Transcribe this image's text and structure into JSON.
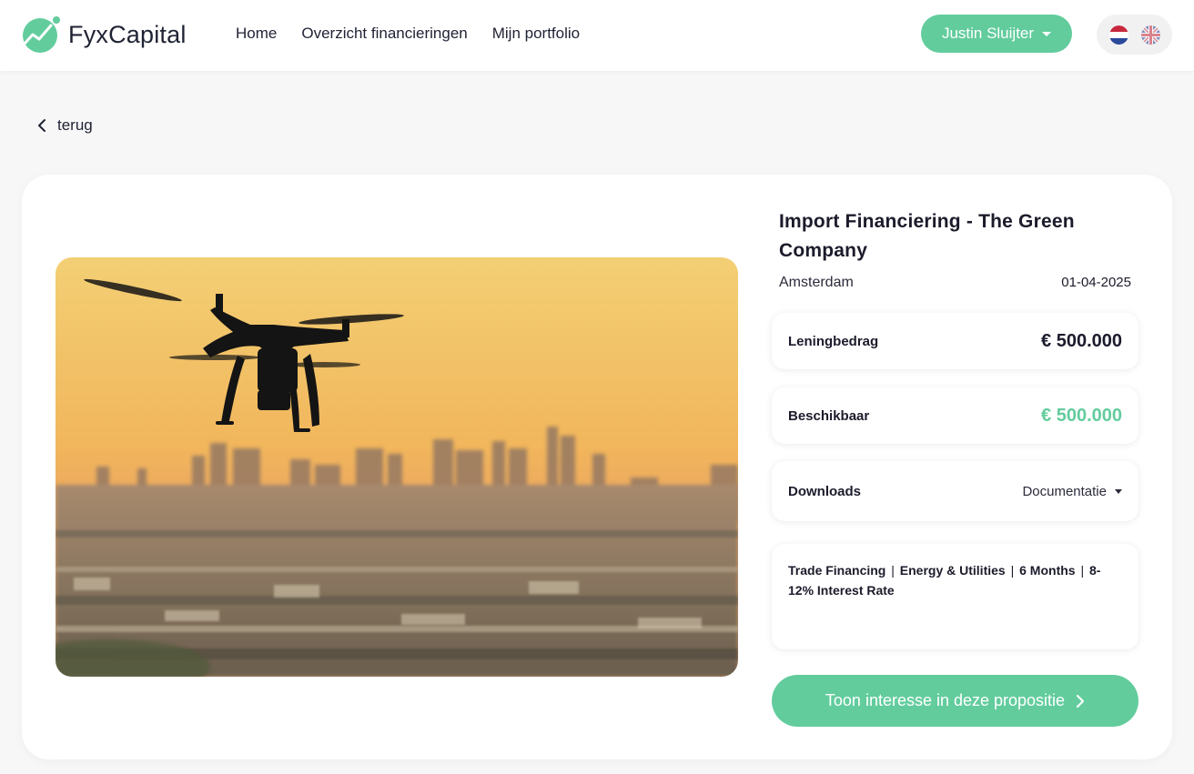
{
  "brand": {
    "name": "FyxCapital",
    "accent": "#62cc9d"
  },
  "nav": {
    "items": [
      {
        "label": "Home"
      },
      {
        "label": "Overzicht financieringen"
      },
      {
        "label": "Mijn portfolio"
      }
    ]
  },
  "user": {
    "name": "Justin Sluijter"
  },
  "languages": [
    {
      "code": "nl",
      "icon": "flag-nl-icon"
    },
    {
      "code": "en",
      "icon": "flag-uk-icon"
    }
  ],
  "back": {
    "label": "terug",
    "icon": "chevron-left-icon"
  },
  "proposition": {
    "title": "Import Financiering - The Green Company",
    "location": "Amsterdam",
    "date": "01-04-2025",
    "loan": {
      "label": "Leningbedrag",
      "value": "€ 500.000"
    },
    "available": {
      "label": "Beschikbaar",
      "value": "€ 500.000"
    },
    "downloads": {
      "label": "Downloads",
      "selected": "Documentatie"
    },
    "tags": [
      "Trade Financing",
      "Energy & Utilities",
      "6 Months",
      "8-12% Interest Rate"
    ],
    "cta": "Toon interesse in deze propositie"
  }
}
